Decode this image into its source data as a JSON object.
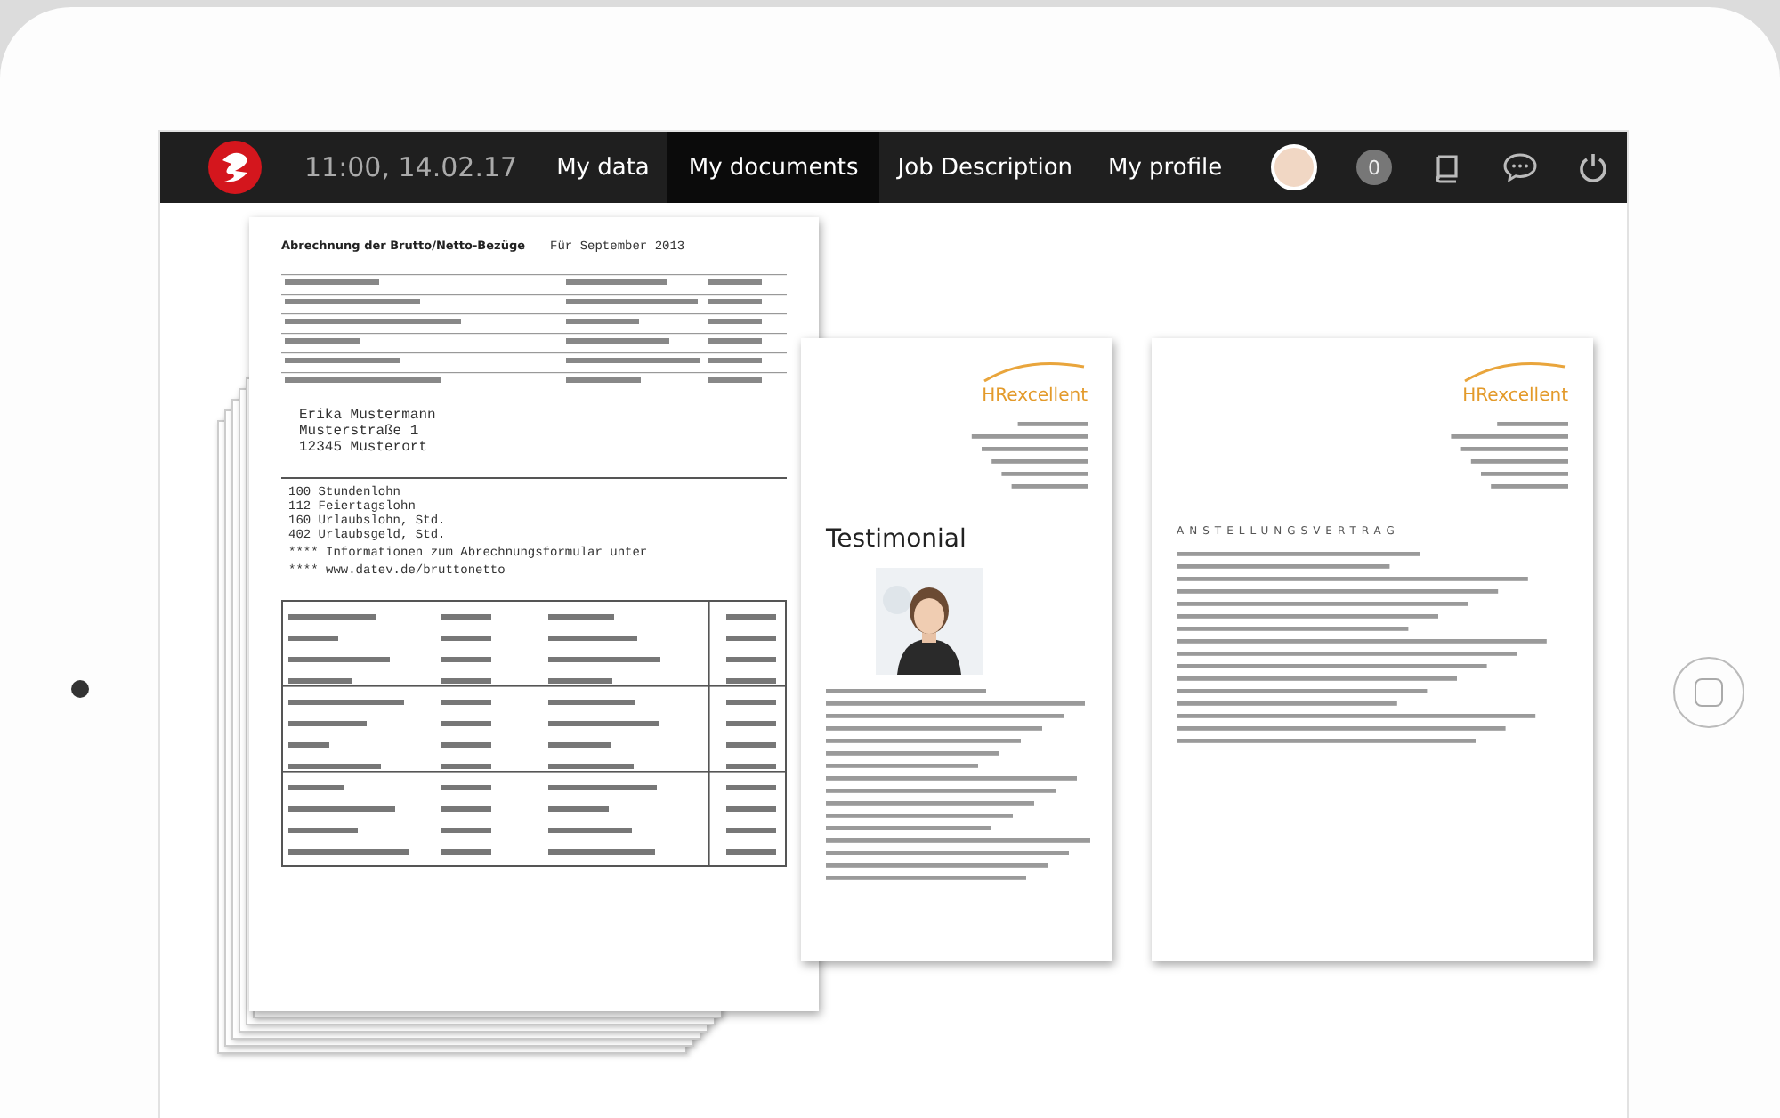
{
  "nav": {
    "time": "11:00, 14.02.17",
    "tabs": [
      {
        "label": "My data",
        "selected": false
      },
      {
        "label": "My documents",
        "selected": true
      },
      {
        "label": "Job Description",
        "selected": false
      },
      {
        "label": "My profile",
        "selected": false
      }
    ],
    "notification_count": "0"
  },
  "documents": [
    {
      "kind": "payslip",
      "heading": "Abrechnung der Brutto/Netto-Bezüge",
      "period": "Für September 2013",
      "address": [
        "Erika Mustermann",
        "Musterstraße 1",
        "12345 Musterort"
      ],
      "items": [
        "100 Stundenlohn",
        "112 Feiertagslohn",
        "160 Urlaubslohn, Std.",
        "402 Urlaubsgeld, Std."
      ],
      "notes": [
        "**** Informationen zum Abrechnungsformular unter",
        "**** www.datev.de/bruttonetto"
      ]
    },
    {
      "kind": "letter",
      "logo": "HRexcellent",
      "title": "Testimonial"
    },
    {
      "kind": "contract",
      "logo": "HRexcellent",
      "title": "ANSTELLUNGSVERTRAG"
    }
  ]
}
